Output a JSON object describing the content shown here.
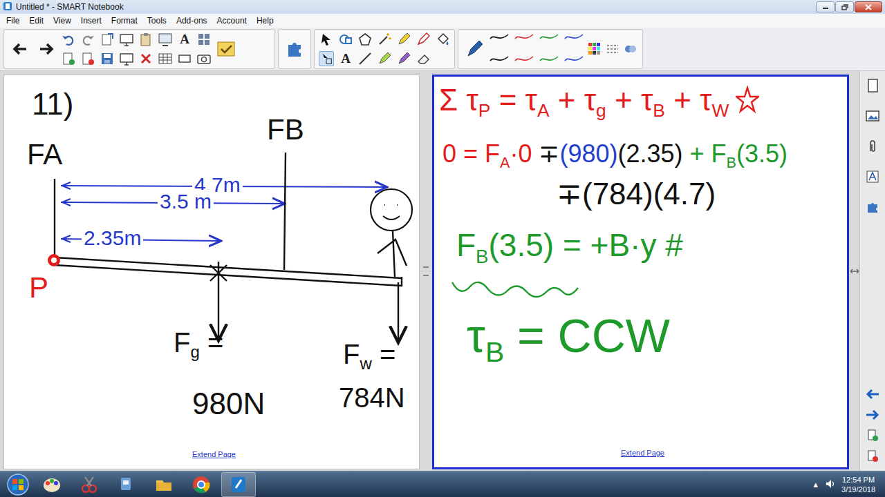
{
  "window": {
    "title": "Untitled * - SMART Notebook"
  },
  "menu": [
    "File",
    "Edit",
    "View",
    "Insert",
    "Format",
    "Tools",
    "Add-ons",
    "Account",
    "Help"
  ],
  "toolbar": {
    "text_glyphs": [
      "A",
      "A"
    ]
  },
  "left_page": {
    "labels": {
      "problem": [
        {
          "text": "11)",
          "sub": false
        }
      ],
      "force_a": [
        {
          "text": "FA",
          "sub": false
        }
      ],
      "force_b": [
        {
          "text": "FB",
          "sub": false
        }
      ],
      "dist_w": [
        {
          "text": "4.7m",
          "sub": false
        }
      ],
      "dist_b": [
        {
          "text": "3.5 m",
          "sub": false
        }
      ],
      "dist_g": [
        {
          "text": "2.35m",
          "sub": false
        }
      ],
      "pivot": [
        {
          "text": "P",
          "sub": false
        }
      ],
      "gravity_label": [
        {
          "text": "F",
          "sub": false
        },
        {
          "text": "g",
          "sub": true
        },
        {
          "text": " =",
          "sub": false
        }
      ],
      "gravity_value": [
        {
          "text": "980N",
          "sub": false
        }
      ],
      "weight_label": [
        {
          "text": "F",
          "sub": false
        },
        {
          "text": "w",
          "sub": true
        },
        {
          "text": " =",
          "sub": false
        }
      ],
      "weight_value": [
        {
          "text": "784N",
          "sub": false
        }
      ]
    },
    "extend_link": "Extend Page"
  },
  "right_page": {
    "lines": [
      {
        "segments": [
          {
            "text": "Σ τ",
            "sub": false,
            "color": "#e31c1c"
          },
          {
            "text": "P",
            "sub": true,
            "color": "#e31c1c"
          },
          {
            "text": " = τ",
            "sub": false,
            "color": "#e31c1c"
          },
          {
            "text": "A",
            "sub": true,
            "color": "#e31c1c"
          },
          {
            "text": " + τ",
            "sub": false,
            "color": "#e31c1c"
          },
          {
            "text": "g",
            "sub": true,
            "color": "#e31c1c"
          },
          {
            "text": " + τ",
            "sub": false,
            "color": "#e31c1c"
          },
          {
            "text": "B",
            "sub": true,
            "color": "#e31c1c"
          },
          {
            "text": " + τ",
            "sub": false,
            "color": "#e31c1c"
          },
          {
            "text": "W",
            "sub": true,
            "color": "#e31c1c"
          }
        ]
      },
      {
        "segments": [
          {
            "text": "0 = F",
            "sub": false,
            "color": "#e31c1c"
          },
          {
            "text": "A",
            "sub": true,
            "color": "#e31c1c"
          },
          {
            "text": "·0 ",
            "sub": false,
            "color": "#e31c1c"
          },
          {
            "text": "∓",
            "sub": false,
            "color": "#111111"
          },
          {
            "text": "(980)",
            "sub": false,
            "color": "#1f3fcf"
          },
          {
            "text": "(2.35)",
            "sub": false,
            "color": "#111111"
          },
          {
            "text": " + F",
            "sub": false,
            "color": "#1d9a2a"
          },
          {
            "text": "B",
            "sub": true,
            "color": "#1d9a2a"
          },
          {
            "text": "(3.5)",
            "sub": false,
            "color": "#1d9a2a"
          }
        ]
      },
      {
        "segments": [
          {
            "text": "∓(784)(4.7)",
            "sub": false,
            "color": "#111111"
          }
        ]
      },
      {
        "segments": [
          {
            "text": "F",
            "sub": false,
            "color": "#1d9a2a"
          },
          {
            "text": "B",
            "sub": true,
            "color": "#1d9a2a"
          },
          {
            "text": "(3.5) = +B·y #",
            "sub": false,
            "color": "#1d9a2a"
          }
        ]
      },
      {
        "segments": [
          {
            "text": "τ",
            "sub": false,
            "color": "#1d9a2a"
          },
          {
            "text": "B",
            "sub": true,
            "color": "#1d9a2a"
          },
          {
            "text": " = CCW",
            "sub": false,
            "color": "#1d9a2a"
          }
        ]
      }
    ],
    "extend_link": "Extend Page"
  },
  "taskbar": {
    "tray_glyph": "▲",
    "time": "12:54 PM",
    "date": "3/19/2018"
  }
}
